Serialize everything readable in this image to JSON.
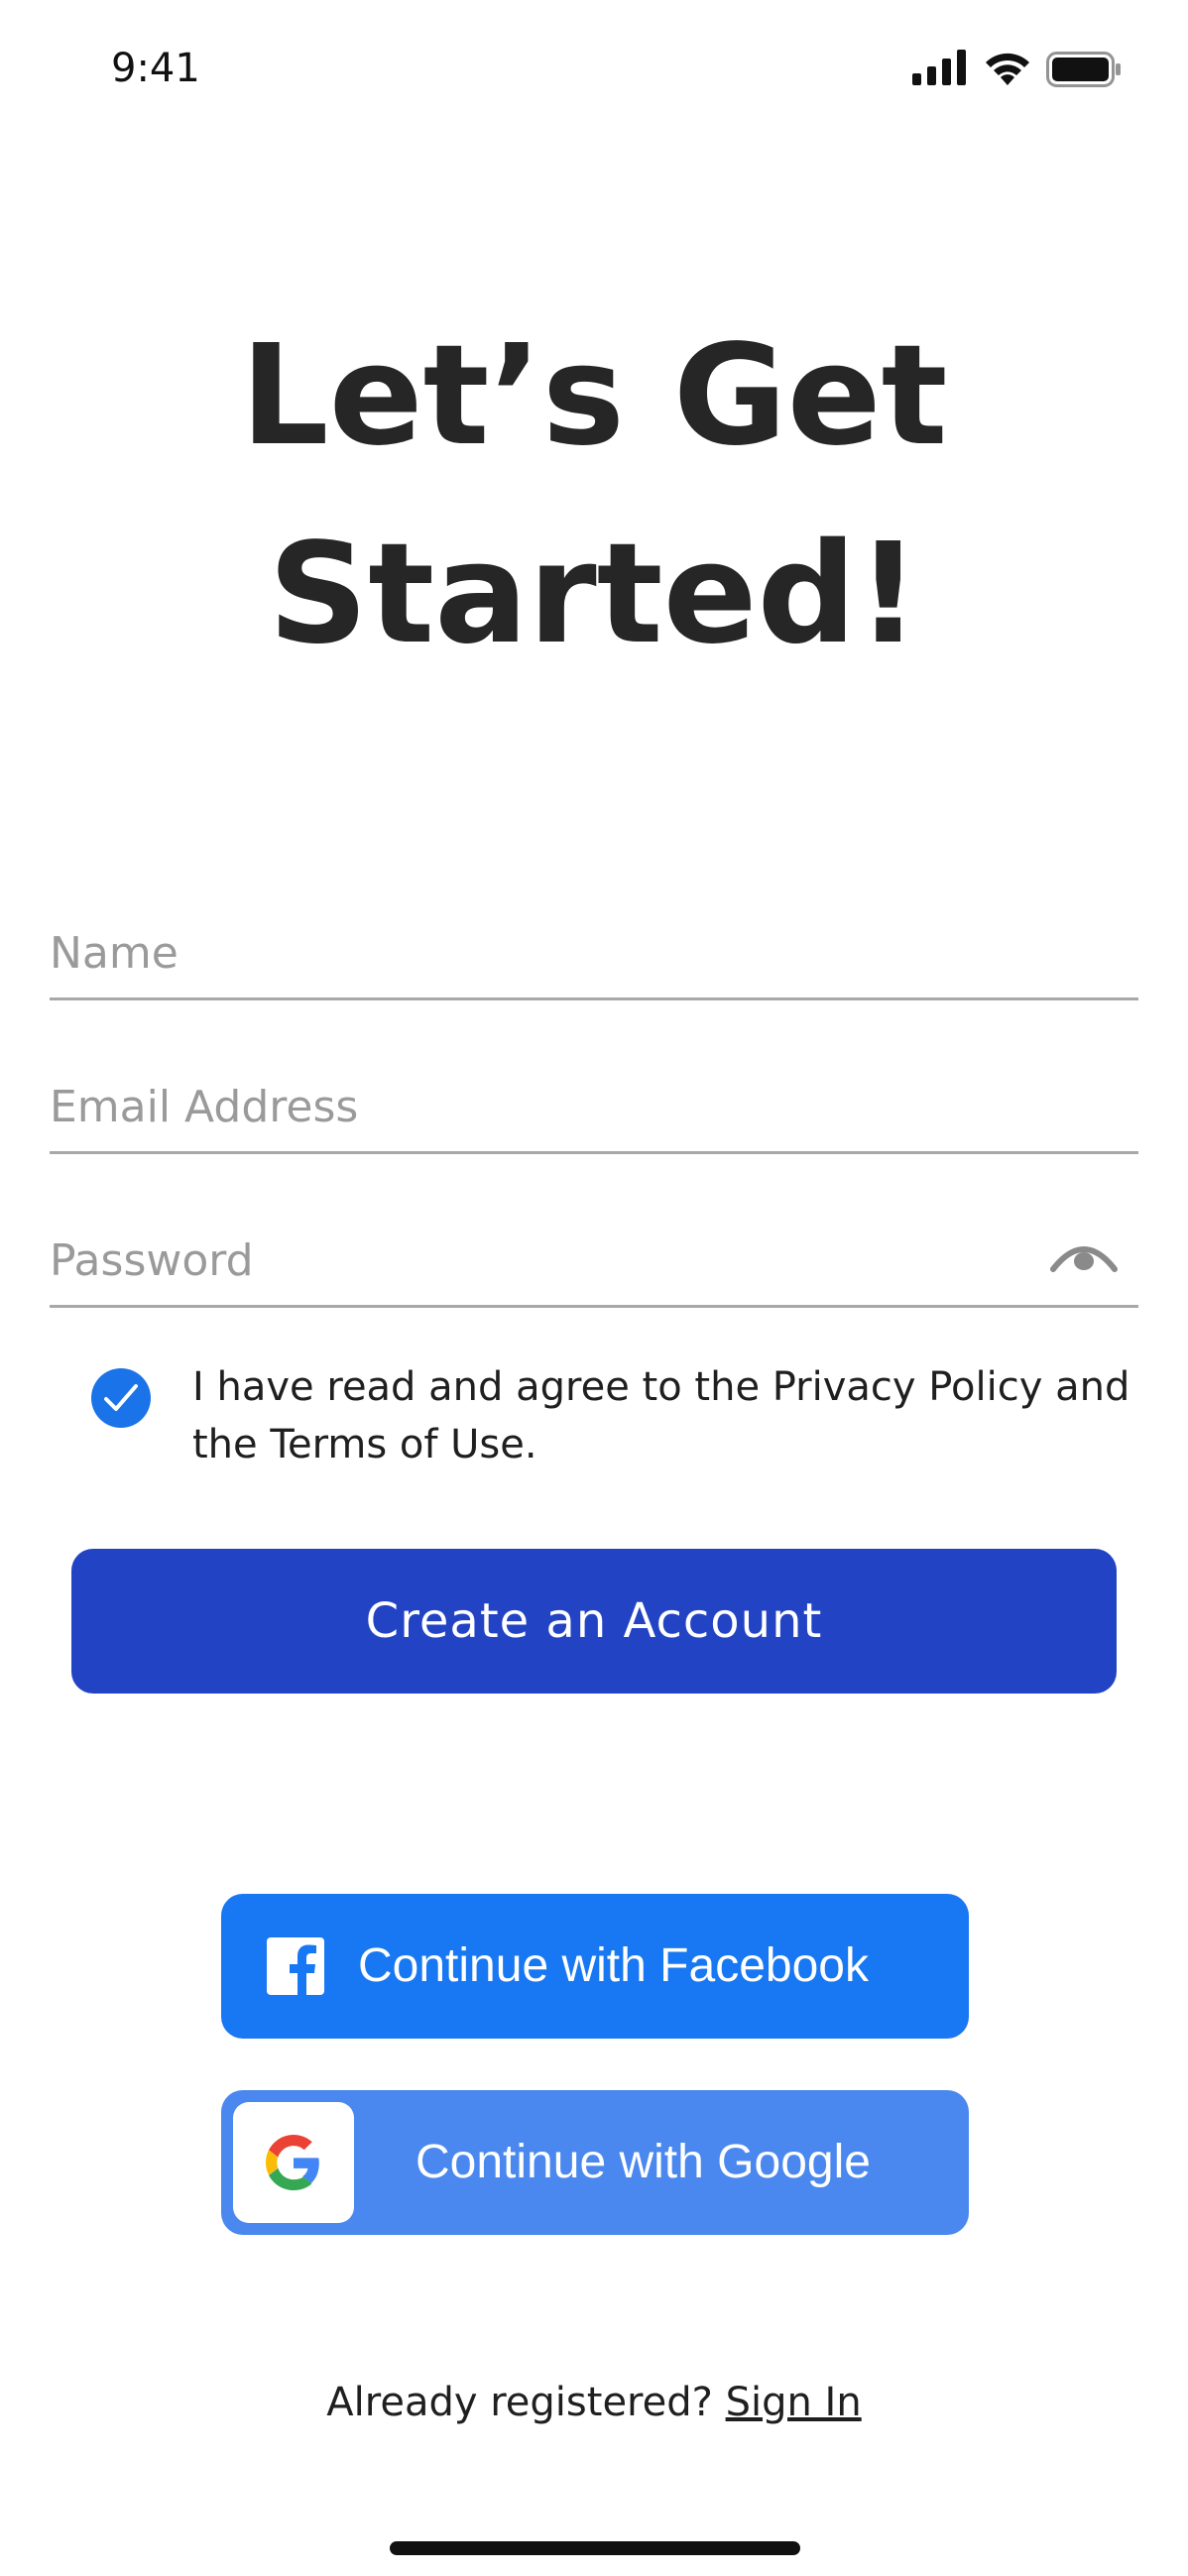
{
  "status_bar": {
    "time": "9:41"
  },
  "title": {
    "line1": "Let’s Get",
    "line2": "Started!"
  },
  "form": {
    "name": {
      "placeholder": "Name",
      "value": ""
    },
    "email": {
      "placeholder": "Email Address",
      "value": ""
    },
    "password": {
      "placeholder": "Password",
      "value": ""
    },
    "agree": {
      "checked": true,
      "text": "I have read and agree to the Privacy Policy and the Terms of Use."
    },
    "create_label": "Create an Account"
  },
  "social": {
    "facebook_label": "Continue with Facebook",
    "google_label": "Continue with Google"
  },
  "footer": {
    "prompt": "Already registered?",
    "signin_label": "Sign In"
  },
  "colors": {
    "primary": "#2244c4",
    "checkbox": "#1a73e8",
    "facebook": "#1877f2",
    "google": "#4a88f0"
  },
  "icons": [
    "signal-icon",
    "wifi-icon",
    "battery-icon",
    "eye-icon",
    "checkmark-icon",
    "facebook-icon",
    "google-icon"
  ]
}
